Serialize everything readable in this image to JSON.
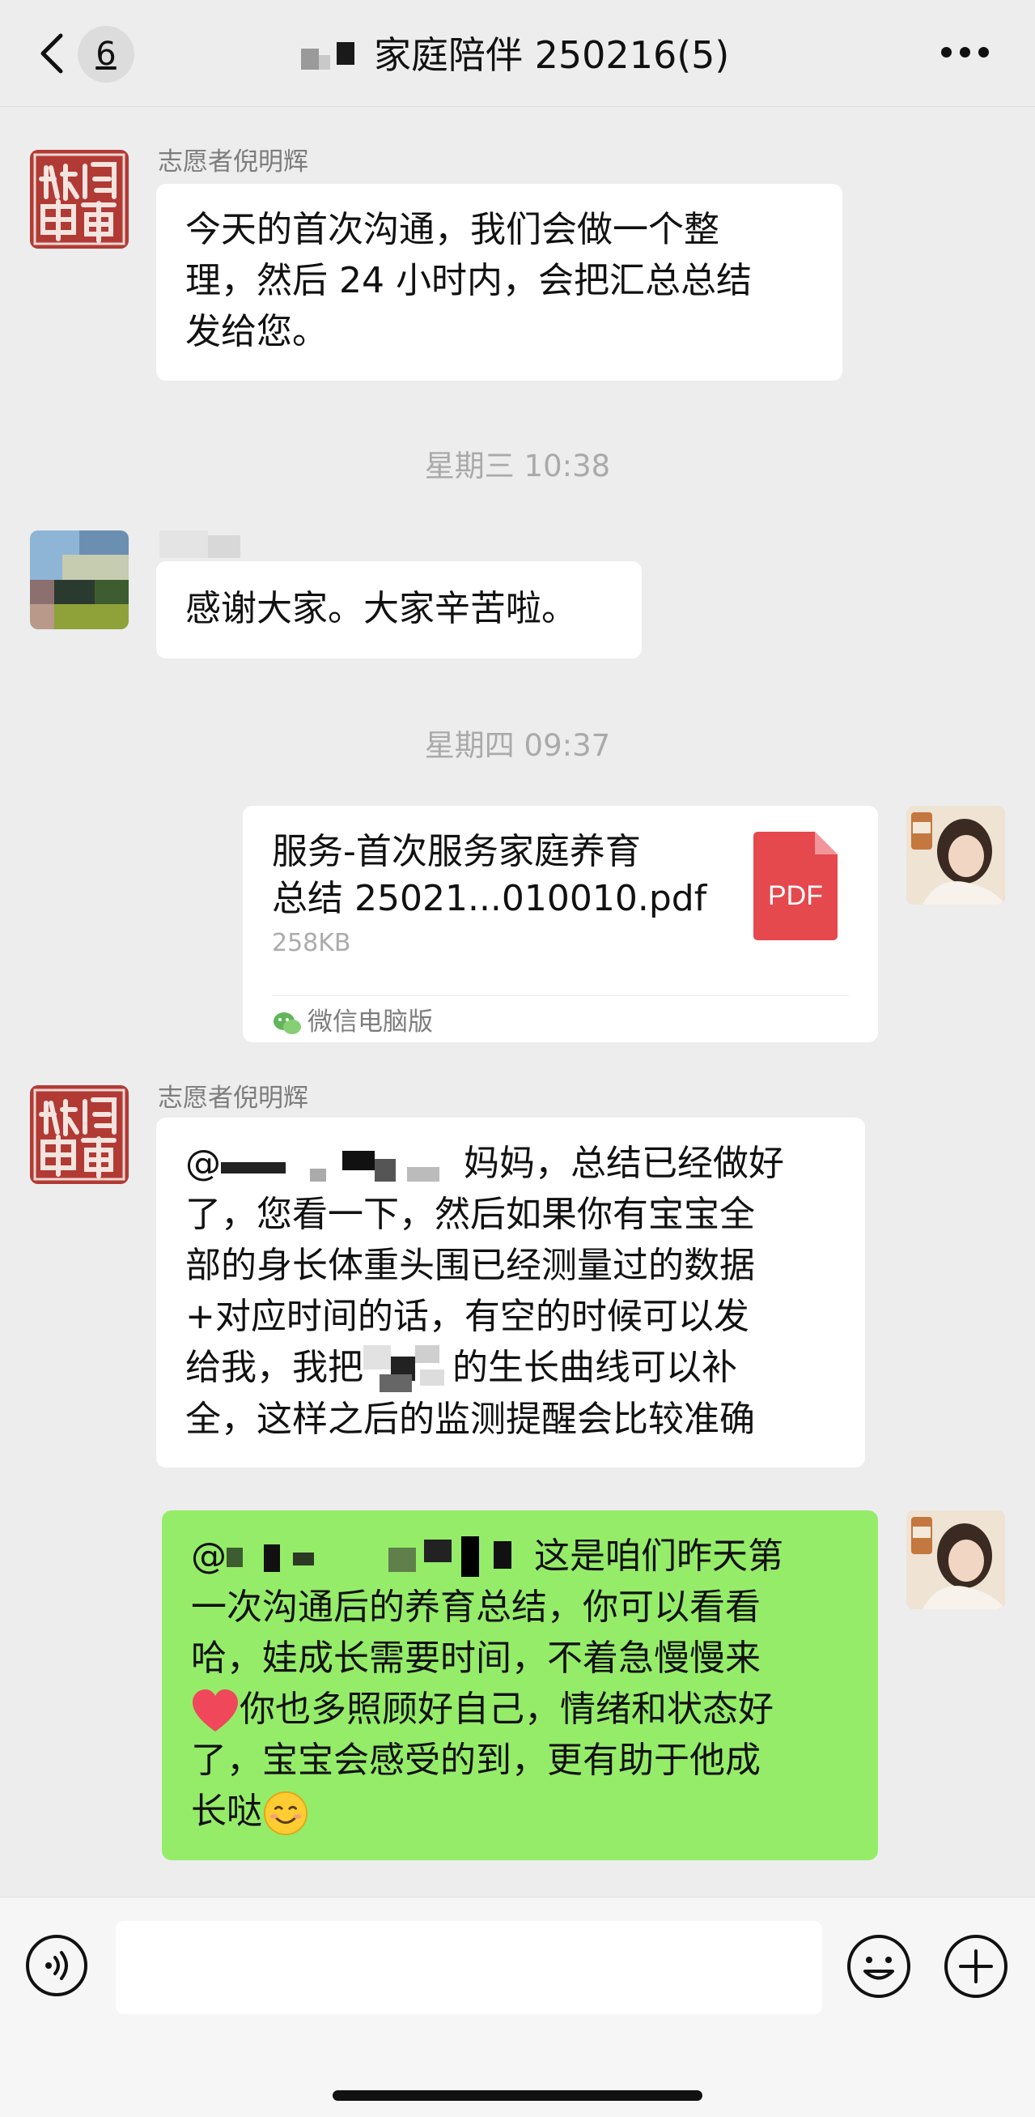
{
  "header": {
    "back_label": "<",
    "unread_count": "6",
    "title": "家庭陪伴 250216(5)",
    "more_label": "..."
  },
  "messages": {
    "m1": {
      "sender": "志愿者倪明辉",
      "line1": "今天的首次沟通，我们会做一个整",
      "line2": "理，然后 24 小时内，会把汇总总结",
      "line3": "发给您。"
    },
    "t1": "星期三 10:38",
    "m2": {
      "text": "感谢大家。大家辛苦啦。"
    },
    "t2": "星期四 09:37",
    "m3": {
      "file_line1": "服务-首次服务家庭养育",
      "file_line2": "总结 25021...010010.pdf",
      "file_size": "258KB",
      "file_type": "PDF",
      "source": "微信电脑版"
    },
    "m4": {
      "sender": "志愿者倪明辉",
      "line1_a": "@",
      "line1_b": "妈妈，总结已经做好",
      "line2": "了，您看一下，然后如果你有宝宝全",
      "line3": "部的身长体重头围已经测量过的数据",
      "line4": "+对应时间的话，有空的时候可以发",
      "line5_a": "给我，我把",
      "line5_b": "的生长曲线可以补",
      "line6": "全，这样之后的监测提醒会比较准确"
    },
    "m5": {
      "line1_a": "@",
      "line1_b": "这是咱们昨天第",
      "line2": "一次沟通后的养育总结，你可以看看",
      "line3": "哈，娃成长需要时间，不着急慢慢来",
      "line4": "你也多照顾好自己，情绪和状态好",
      "line5": "了，宝宝会感受的到，更有助于他成",
      "line6": "长哒"
    }
  },
  "icons": {
    "back": "chevron-left-icon",
    "more": "more-icon",
    "pdf": "pdf-file-icon",
    "source": "wechat-icon",
    "heart": "red-heart-emoji",
    "smile": "smiling-face-emoji",
    "voice": "voice-icon",
    "emoji": "emoji-icon",
    "plus": "plus-icon"
  },
  "colors": {
    "background": "#ededed",
    "bubble_received": "#ffffff",
    "bubble_sent": "#95ec69",
    "pdf_red": "#e5484d",
    "seal_red": "#b13a35"
  }
}
